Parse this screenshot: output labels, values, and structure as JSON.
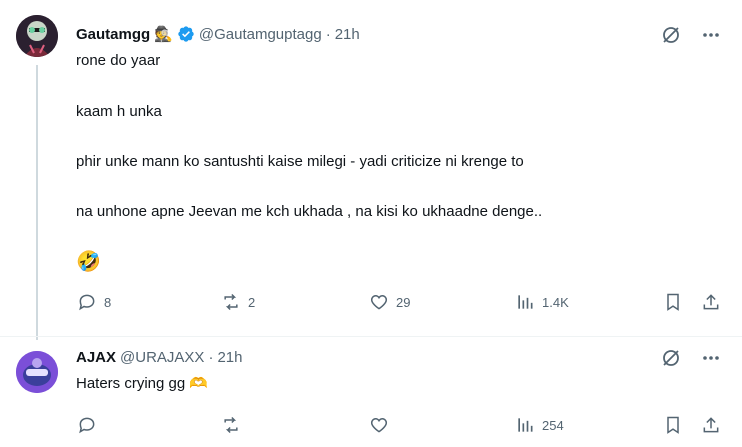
{
  "tweets": [
    {
      "name": "Gautamgg",
      "badge_emoji": "🕵",
      "handle": "@Gautamguptagg",
      "separator": "·",
      "time": "21h",
      "verified": true,
      "lines": [
        "rone do yaar",
        "kaam h unka",
        "phir unke mann ko santushti kaise milegi - yadi criticize ni krenge to",
        "na unhone apne Jeevan me kch ukhada , na kisi ko ukhaadne denge..",
        "🤣"
      ],
      "stats": {
        "replies": "8",
        "reposts": "2",
        "likes": "29",
        "views": "1.4K"
      }
    },
    {
      "name": "AJAX",
      "handle": "@URAJAXX",
      "separator": "·",
      "time": "21h",
      "lines": [
        "Haters crying gg 🫶"
      ],
      "stats": {
        "replies": "",
        "reposts": "",
        "likes": "",
        "views": "254"
      }
    }
  ],
  "icons": {
    "accent": "#1d9bf0",
    "muted": "#536471",
    "names": [
      "grok-icon",
      "more-icon",
      "reply-icon",
      "repost-icon",
      "like-icon",
      "views-icon",
      "bookmark-icon",
      "share-icon",
      "verified-icon"
    ]
  }
}
